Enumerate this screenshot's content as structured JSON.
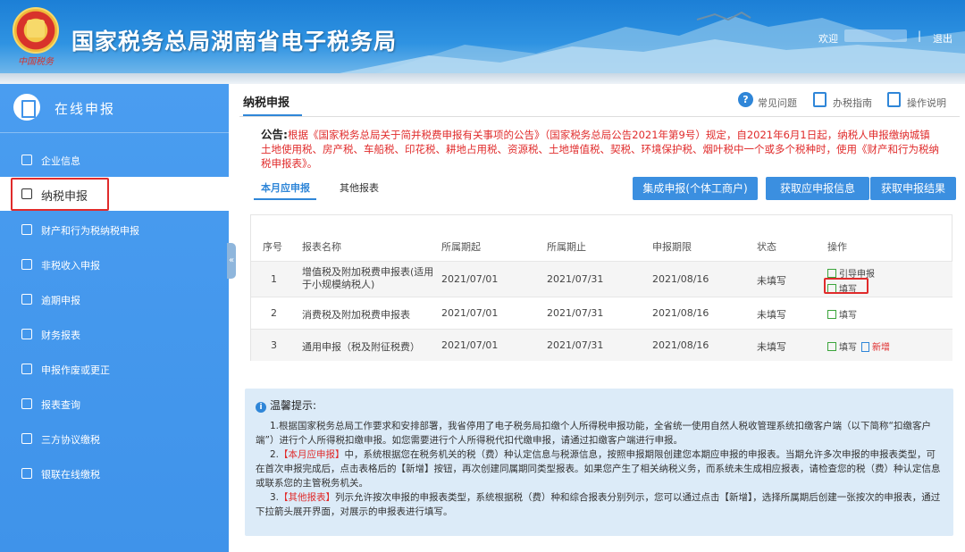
{
  "header": {
    "title": "国家税务总局湖南省电子税务局",
    "logo_sub": "中国税务",
    "welcome": "欢迎",
    "separator": "|",
    "logout": "退出"
  },
  "sidebar": {
    "title": "在线申报",
    "items": [
      {
        "label": "企业信息"
      },
      {
        "label": "纳税申报"
      },
      {
        "label": "财产和行为税纳税申报"
      },
      {
        "label": "非税收入申报"
      },
      {
        "label": "逾期申报"
      },
      {
        "label": "财务报表"
      },
      {
        "label": "申报作废或更正"
      },
      {
        "label": "报表查询"
      },
      {
        "label": "三方协议缴税"
      },
      {
        "label": "银联在线缴税"
      }
    ],
    "collapse": "«"
  },
  "main": {
    "tab": "纳税申报",
    "help": {
      "faq": "常见问题",
      "guide": "办税指南",
      "manual": "操作说明",
      "faq_icon": "?"
    },
    "notice": {
      "label": "公告:",
      "text": "根据《国家税务总局关于简并税费申报有关事项的公告》（国家税务总局公告2021年第9号）规定，自2021年6月1日起，纳税人申报缴纳城镇土地使用税、房产税、车船税、印花税、耕地占用税、资源税、土地增值税、契税、环境保护税、烟叶税中一个或多个税种时，使用《财产和行为税纳税申报表》。"
    },
    "subtabs": [
      "本月应申报",
      "其他报表"
    ],
    "buttons": [
      "集成申报(个体工商户)",
      "获取应申报信息",
      "获取申报结果"
    ],
    "table": {
      "headers": [
        "序号",
        "报表名称",
        "所属期起",
        "所属期止",
        "申报期限",
        "状态",
        "操作"
      ],
      "rows": [
        {
          "no": "1",
          "name": "增值税及附加税费申报表(适用于小规模纳税人)",
          "start": "2021/07/01",
          "end": "2021/07/31",
          "deadline": "2021/08/16",
          "status": "未填写",
          "ops": [
            "引导申报",
            "填写"
          ]
        },
        {
          "no": "2",
          "name": "消费税及附加税费申报表",
          "start": "2021/07/01",
          "end": "2021/07/31",
          "deadline": "2021/08/16",
          "status": "未填写",
          "ops": [
            "填写"
          ]
        },
        {
          "no": "3",
          "name": "通用申报（税及附征税费）",
          "start": "2021/07/01",
          "end": "2021/07/31",
          "deadline": "2021/08/16",
          "status": "未填写",
          "ops": [
            "填写",
            "新增"
          ]
        }
      ]
    },
    "tips": {
      "title": "温馨提示:",
      "icon": "i",
      "p1": "1.根据国家税务总局工作要求和安排部署，我省停用了电子税务局扣缴个人所得税申报功能，全省统一使用自然人税收管理系统扣缴客户端（以下简称“扣缴客户端”）进行个人所得税扣缴申报。如您需要进行个人所得税代扣代缴申报，请通过扣缴客户端进行申报。",
      "p2_pre": "2.",
      "p2_hi": "【本月应申报】",
      "p2": "中，系统根据您在税务机关的税（费）种认定信息与税源信息，按照申报期限创建您本期应申报的申报表。当期允许多次申报的申报表类型，可在首次申报完成后，点击表格后的【新增】按钮，再次创建同属期同类型报表。如果您产生了相关纳税义务，而系统未生成相应报表，请检查您的税（费）种认定信息或联系您的主管税务机关。",
      "p3_pre": "3.",
      "p3_hi": "【其他报表】",
      "p3": "列示允许按次申报的申报表类型，系统根据税（费）种和综合报表分别列示，您可以通过点击【新增】，选择所属期后创建一张按次的申报表，通过下拉箭头展开界面，对展示的申报表进行填写。"
    }
  },
  "colors": {
    "accent": "#3b8fe0",
    "sidebar": "#4a9df0",
    "alert": "#e02b2b",
    "tips_bg": "#dcebf8"
  }
}
